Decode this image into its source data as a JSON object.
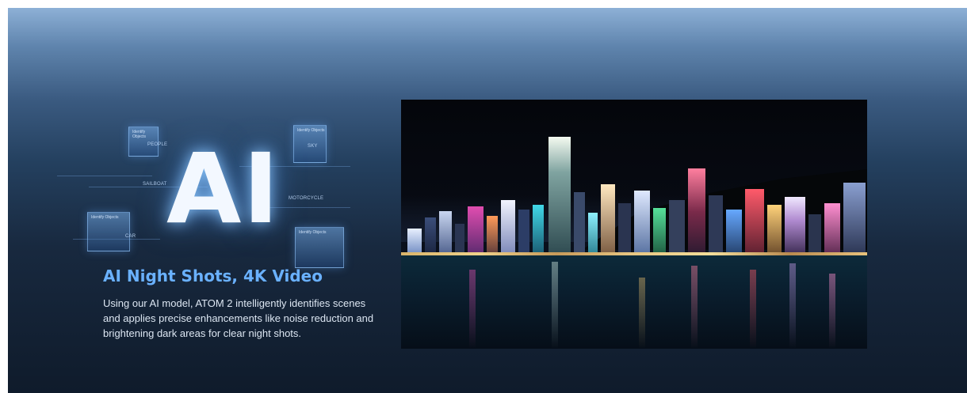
{
  "hero": {
    "badge_text": "AI",
    "title": "AI Night Shots, 4K Video",
    "description": "Using our AI model, ATOM 2 intelligently identifies scenes and applies precise enhancements like noise reduction and brightening dark areas for clear night shots.",
    "detection_tags": [
      "PEOPLE",
      "SAILBOAT",
      "SKY",
      "MOTORCYCLE",
      "CAR"
    ],
    "panel_labels": [
      "Identify Objects",
      "Identify Objects",
      "Identify Objects",
      "Identify Objects"
    ]
  },
  "colors": {
    "title_accent": "#6ab1ff",
    "body_text": "#dce6f2"
  }
}
